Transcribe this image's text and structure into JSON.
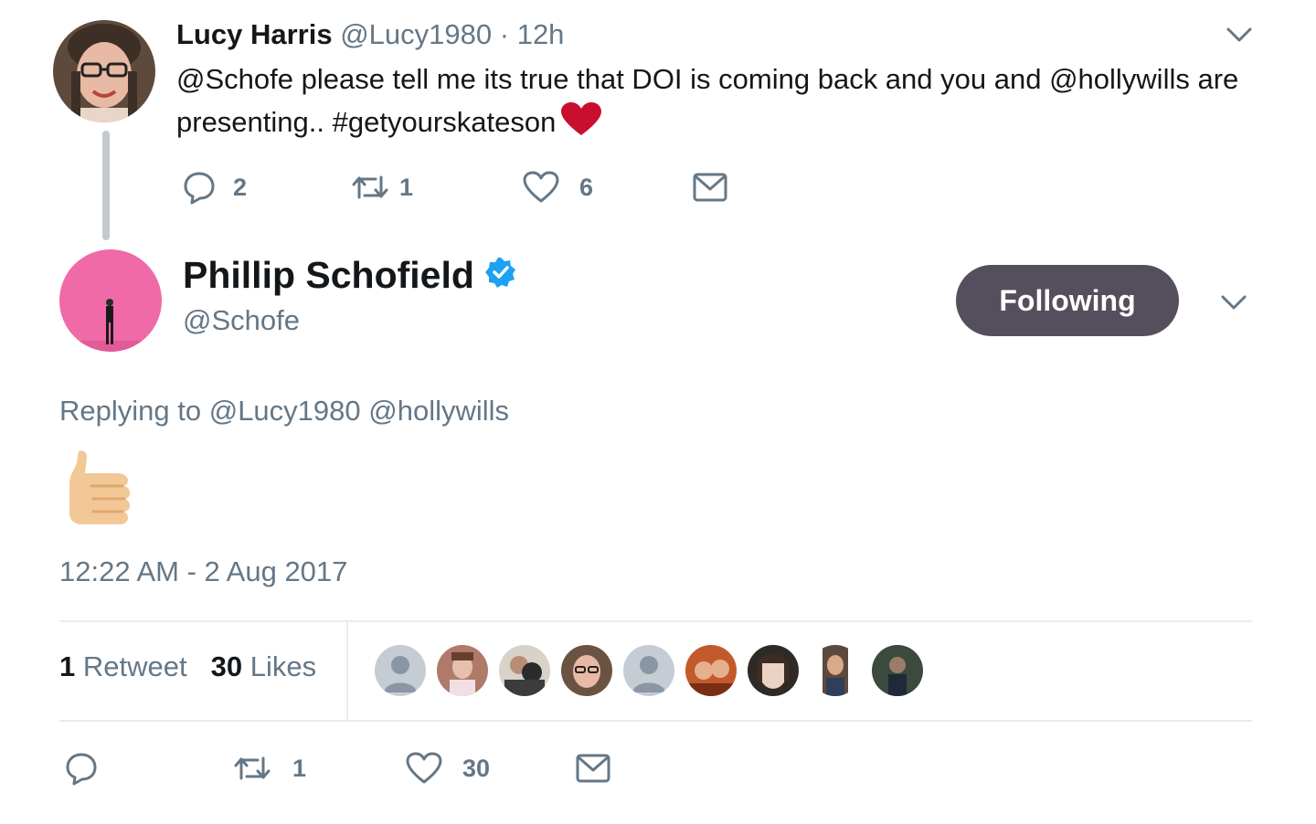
{
  "parent_tweet": {
    "author_name": "Lucy Harris",
    "author_handle": "@Lucy1980",
    "time_sep": "·",
    "time_ago": "12h",
    "text": "@Schofe please tell me its true that DOI is coming back and you and @hollywills are presenting.. #getyourskateson",
    "emoji": "red-heart",
    "replies": "2",
    "retweets": "1",
    "likes": "6"
  },
  "main_tweet": {
    "author_name": "Phillip Schofield",
    "author_handle": "@Schofe",
    "verified": true,
    "follow_button_label": "Following",
    "replying_label": "Replying to",
    "replying_mentions": "@Lucy1980 @hollywills",
    "emoji": "thumbs-up",
    "timestamp": "12:22 AM - 2 Aug 2017",
    "retweet_count": "1",
    "retweet_label": "Retweet",
    "like_count": "30",
    "like_label": "Likes",
    "liker_avatars": 9,
    "action_retweets": "1",
    "action_likes": "30"
  },
  "colors": {
    "muted": "#657786",
    "follow_button_bg": "#554f5d",
    "verified_blue": "#1da1f2",
    "heart_red": "#c8102e",
    "avatar_pink": "#f06aa8"
  }
}
